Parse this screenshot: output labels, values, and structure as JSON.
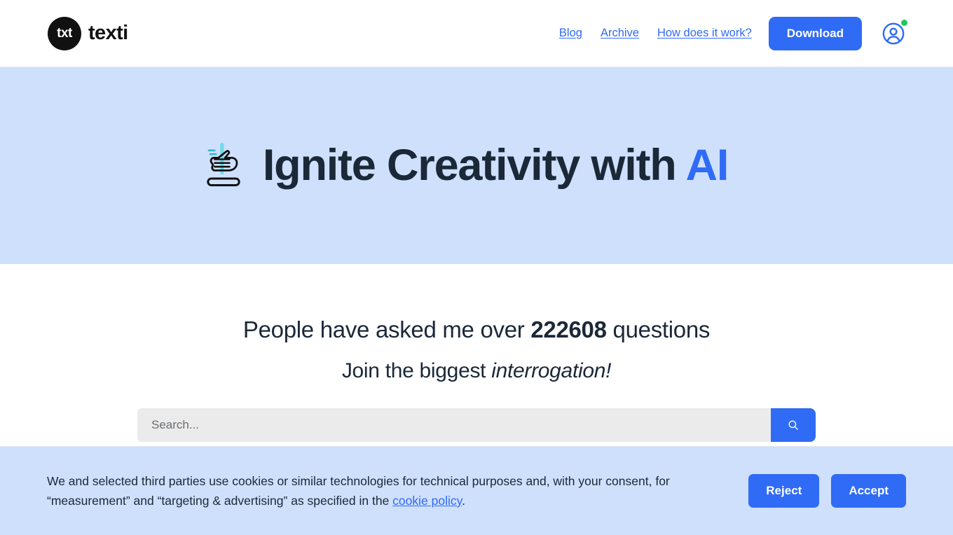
{
  "header": {
    "logo_mark_text": "txt",
    "brand_name": "texti",
    "nav": [
      {
        "label": "Blog",
        "name": "nav-link-blog"
      },
      {
        "label": "Archive",
        "name": "nav-link-archive"
      },
      {
        "label": "How does it work?",
        "name": "nav-link-how-does-it-work"
      }
    ],
    "download_label": "Download",
    "avatar_icon": "user-circle-icon",
    "status_dot_color": "#22c55e"
  },
  "hero": {
    "icon": "writing-hand-icon",
    "title_main": "Ignite Creativity with ",
    "title_accent": "AI",
    "background_color": "#cfe0fd",
    "accent_color": "#2f6bf5"
  },
  "main": {
    "stat_prefix": "People have asked me over ",
    "stat_count": "222608",
    "stat_suffix": " questions",
    "join_prefix": "Join the biggest ",
    "join_emphasis": "interrogation!",
    "search": {
      "placeholder": "Search...",
      "value": "",
      "button_icon": "search-icon"
    }
  },
  "cookie_banner": {
    "text_part1": "We and selected third parties use cookies or similar technologies for technical purposes and, with your consent, for “measurement” and “targeting & advertising” as specified in the ",
    "link_label": "cookie policy",
    "text_part2": ".",
    "reject_label": "Reject",
    "accept_label": "Accept",
    "background_color": "#cfe0fd"
  }
}
